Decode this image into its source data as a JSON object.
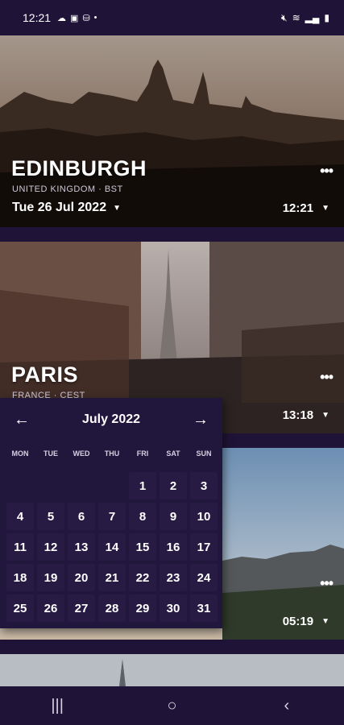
{
  "status_bar": {
    "time": "12:21",
    "left_icons": [
      "cloud-icon",
      "storage-icon",
      "shop-icon",
      "dot-icon"
    ],
    "right_icons": [
      "mute-icon",
      "wifi-icon",
      "signal-icon",
      "battery-icon"
    ]
  },
  "cards": [
    {
      "city": "EDINBURGH",
      "meta": "UNITED KINGDOM · BST",
      "date": "Tue 26 Jul 2022",
      "time": "12:21",
      "menu": "•••"
    },
    {
      "city": "PARIS",
      "meta": "FRANCE · CEST",
      "date": "",
      "time": "13:18",
      "menu": "•••"
    },
    {
      "city": "",
      "meta": "",
      "date": "",
      "time": "05:19",
      "menu": "•••"
    }
  ],
  "calendar": {
    "title": "July 2022",
    "prev": "←",
    "next": "→",
    "weekdays": [
      "MON",
      "TUE",
      "WED",
      "THU",
      "FRI",
      "SAT",
      "SUN"
    ],
    "weeks": [
      [
        "",
        "",
        "",
        "",
        "1",
        "2",
        "3"
      ],
      [
        "4",
        "5",
        "6",
        "7",
        "8",
        "9",
        "10"
      ],
      [
        "11",
        "12",
        "13",
        "14",
        "15",
        "16",
        "17"
      ],
      [
        "18",
        "19",
        "20",
        "21",
        "22",
        "23",
        "24"
      ],
      [
        "25",
        "26",
        "27",
        "28",
        "29",
        "30",
        "31"
      ]
    ]
  },
  "nav": {
    "recent": "|||",
    "home": "○",
    "back": "‹"
  },
  "colors": {
    "background": "#1f1438",
    "calendar_bg": "#21163c",
    "day_bg": "#271b44"
  }
}
